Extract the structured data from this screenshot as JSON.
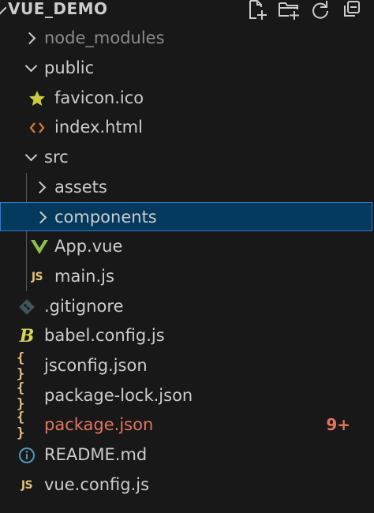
{
  "explorer": {
    "title": "VUE_DEMO",
    "actions": [
      {
        "name": "new-file-icon"
      },
      {
        "name": "new-folder-icon"
      },
      {
        "name": "refresh-icon"
      },
      {
        "name": "collapse-all-icon"
      }
    ]
  },
  "tree": {
    "items": [
      {
        "label": "node_modules",
        "type": "folder",
        "expanded": false,
        "icon": "chevron-right-icon"
      },
      {
        "label": "public",
        "type": "folder",
        "expanded": true,
        "icon": "chevron-down-icon"
      },
      {
        "label": "favicon.ico",
        "type": "file",
        "icon": "star-icon"
      },
      {
        "label": "index.html",
        "type": "file",
        "icon": "html-icon"
      },
      {
        "label": "src",
        "type": "folder",
        "expanded": true,
        "icon": "chevron-down-icon"
      },
      {
        "label": "assets",
        "type": "folder",
        "expanded": false,
        "icon": "chevron-right-icon"
      },
      {
        "label": "components",
        "type": "folder",
        "expanded": false,
        "selected": true,
        "icon": "chevron-right-icon"
      },
      {
        "label": "App.vue",
        "type": "file",
        "icon": "vue-icon"
      },
      {
        "label": "main.js",
        "type": "file",
        "icon": "js-icon",
        "icon_text": "JS"
      },
      {
        "label": ".gitignore",
        "type": "file",
        "icon": "git-icon"
      },
      {
        "label": "babel.config.js",
        "type": "file",
        "icon": "babel-icon",
        "icon_text": "B"
      },
      {
        "label": "jsconfig.json",
        "type": "file",
        "icon": "json-icon",
        "icon_text": "{ }"
      },
      {
        "label": "package-lock.json",
        "type": "file",
        "icon": "json-icon",
        "icon_text": "{ }"
      },
      {
        "label": "package.json",
        "type": "file",
        "icon": "json-icon",
        "icon_text": "{ }",
        "modified": true,
        "badge": "9+"
      },
      {
        "label": "README.md",
        "type": "file",
        "icon": "info-icon"
      },
      {
        "label": "vue.config.js",
        "type": "file",
        "icon": "js-icon",
        "icon_text": "JS"
      }
    ]
  },
  "colors": {
    "background": "#181818",
    "text": "#cccccc",
    "selection_bg": "#04395e",
    "selection_border": "#2a7fd4",
    "modified": "#e2765e",
    "json_yellow": "#e5c07b",
    "vue_green": "#8dc149",
    "html_orange": "#e37933",
    "info_blue": "#519aba"
  }
}
